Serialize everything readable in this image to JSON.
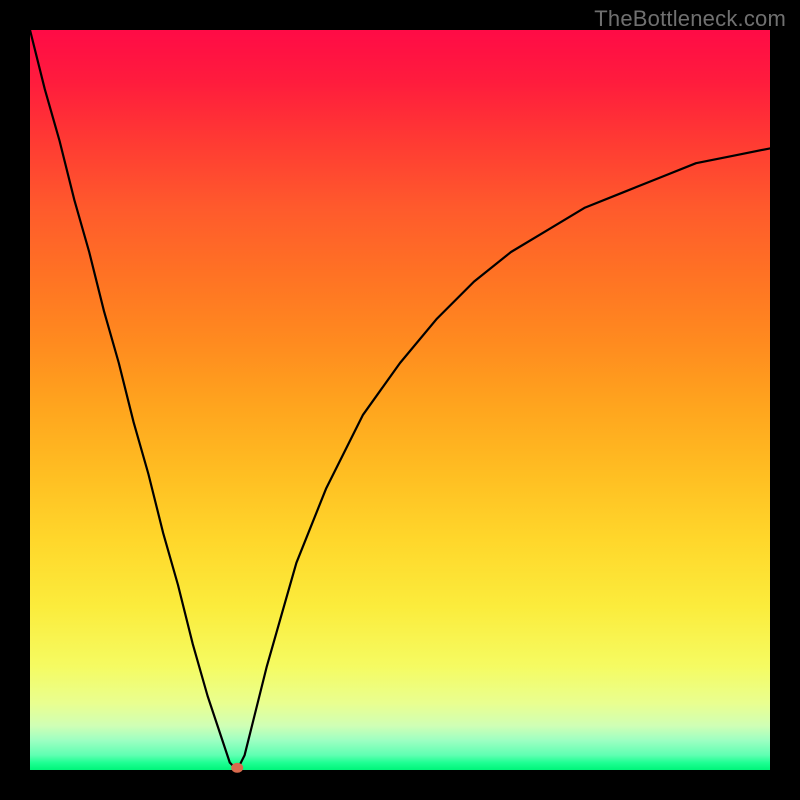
{
  "watermark": "TheBottleneck.com",
  "chart_data": {
    "type": "line",
    "title": "",
    "xlabel": "",
    "ylabel": "",
    "xlim": [
      0,
      100
    ],
    "ylim": [
      0,
      100
    ],
    "grid": false,
    "legend": false,
    "background": {
      "gradient_direction": "top-to-bottom",
      "stops": [
        {
          "pos": 0.0,
          "color": "#ff0b46"
        },
        {
          "pos": 0.15,
          "color": "#ff3a33"
        },
        {
          "pos": 0.33,
          "color": "#ff7224"
        },
        {
          "pos": 0.51,
          "color": "#ffa51e"
        },
        {
          "pos": 0.69,
          "color": "#ffd72b"
        },
        {
          "pos": 0.86,
          "color": "#f5fb62"
        },
        {
          "pos": 0.94,
          "color": "#d0ffb5"
        },
        {
          "pos": 0.98,
          "color": "#5fffb2"
        },
        {
          "pos": 1.0,
          "color": "#00f57a"
        }
      ]
    },
    "series": [
      {
        "name": "bottleneck-curve",
        "x": [
          0,
          2,
          4,
          6,
          8,
          10,
          12,
          14,
          16,
          18,
          20,
          22,
          24,
          26,
          27,
          28,
          29,
          30,
          32,
          34,
          36,
          40,
          45,
          50,
          55,
          60,
          65,
          70,
          75,
          80,
          85,
          90,
          95,
          100
        ],
        "y": [
          100,
          92,
          85,
          77,
          70,
          62,
          55,
          47,
          40,
          32,
          25,
          17,
          10,
          4,
          1,
          0,
          2,
          6,
          14,
          21,
          28,
          38,
          48,
          55,
          61,
          66,
          70,
          73,
          76,
          78,
          80,
          82,
          83,
          84
        ]
      }
    ],
    "marker": {
      "x": 28,
      "y": 0.3,
      "color": "#d96a4d"
    }
  }
}
